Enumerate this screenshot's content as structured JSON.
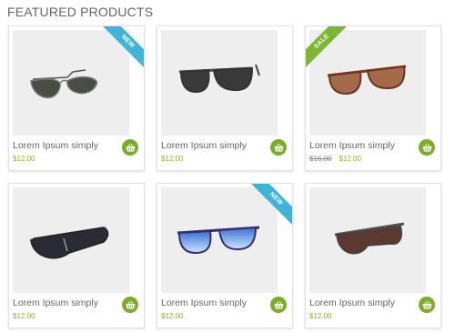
{
  "section": {
    "title": "FEATURED PRODUCTS"
  },
  "products": [
    {
      "name": "Lorem Ipsum simply",
      "price": "$12.00",
      "old_price": "",
      "badge": "NEW"
    },
    {
      "name": "Lorem Ipsum simply",
      "price": "$12.00",
      "old_price": "",
      "badge": ""
    },
    {
      "name": "Lorem Ipsum simply",
      "price": "$12.00",
      "old_price": "$16.00",
      "badge": "SALE"
    },
    {
      "name": "Lorem Ipsum simply",
      "price": "$12.00",
      "old_price": "",
      "badge": ""
    },
    {
      "name": "Lorem Ipsum simply",
      "price": "$12.00",
      "old_price": "",
      "badge": "NEW"
    },
    {
      "name": "Lorem Ipsum simply",
      "price": "$12.00",
      "old_price": "",
      "badge": ""
    }
  ],
  "icons": {
    "cart": "shopping-basket-icon"
  },
  "colors": {
    "accent": "#7cad2a",
    "new_badge": "#3fb4d6",
    "sale_badge": "#7cb82f",
    "price": "#8bb52c"
  }
}
